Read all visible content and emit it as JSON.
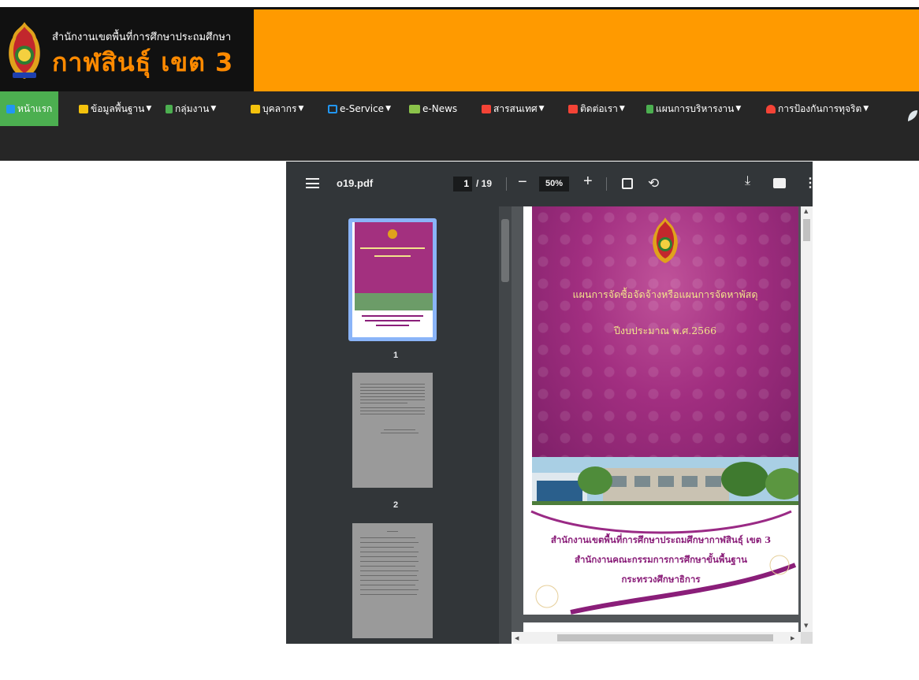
{
  "site": {
    "logo_line1": "สำนักงานเขตพื้นที่การศึกษาประถมศึกษา",
    "logo_line2": "กาฬสินธุ์ เขต 3"
  },
  "nav": {
    "items": [
      {
        "label": "หน้าแรก",
        "icon": "home-icon",
        "color": "#2196f3"
      },
      {
        "label": "ข้อมูลพื้นฐาน",
        "icon": "users-icon",
        "color": "#f4c20d"
      },
      {
        "label": "กลุ่มงาน",
        "icon": "file-icon",
        "color": "#4caf50"
      },
      {
        "label": "บุคลากร",
        "icon": "user-icon",
        "color": "#f4c20d"
      },
      {
        "label": "e-Service",
        "icon": "tablet-icon",
        "color": "#2196f3"
      },
      {
        "label": "e-News",
        "icon": "newspaper-icon",
        "color": "#8bc34a"
      },
      {
        "label": "สารสนเทศ",
        "icon": "print-icon",
        "color": "#f44336"
      },
      {
        "label": "ติดต่อเรา",
        "icon": "print-icon",
        "color": "#f44336"
      },
      {
        "label": "แผนการบริหารงาน",
        "icon": "clipboard-icon",
        "color": "#4caf50"
      },
      {
        "label": "การป้องกันการทุจริต",
        "icon": "bell-icon",
        "color": "#f44336"
      }
    ]
  },
  "pdf": {
    "filename": "o19.pdf",
    "current_page": "1",
    "total": "/ 19",
    "zoom": "50%",
    "thumbnails": [
      {
        "label": "1"
      },
      {
        "label": "2"
      }
    ],
    "cover": {
      "title1": "แผนการจัดซื้อจัดจ้างหรือแผนการจัดหาพัสดุ",
      "title2": "ปีงบประมาณ พ.ศ.2566",
      "org1": "สำนักงานเขตพื้นที่การศึกษาประถมศึกษากาฬสินธุ์ เขต 3",
      "org2": "สำนักงานคณะกรรมการการศึกษาขั้นพื้นฐาน",
      "org3": "กระทรวงศึกษาธิการ"
    }
  }
}
